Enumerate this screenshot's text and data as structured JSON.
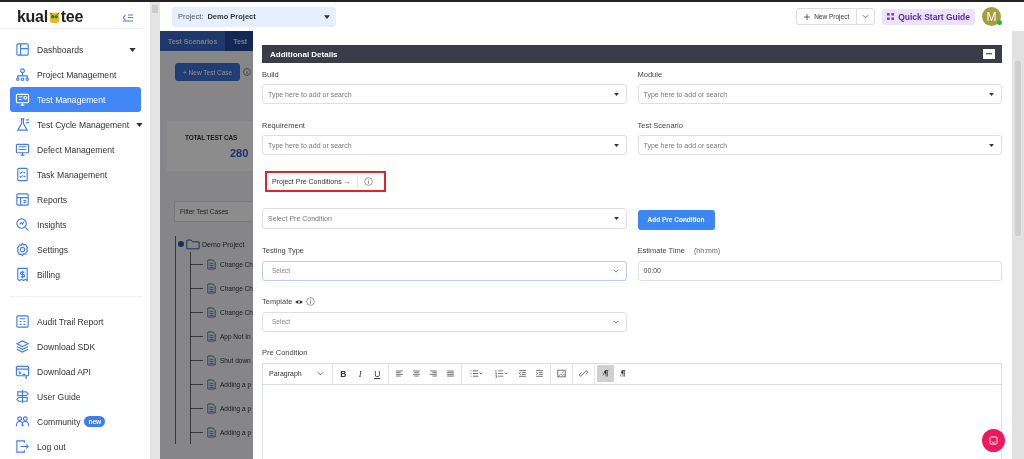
{
  "sidebar": {
    "logo": [
      "kual",
      "tee"
    ],
    "groups": [
      [
        {
          "label": "Dashboards",
          "selected": false,
          "caret": true
        },
        {
          "label": "Project Management",
          "selected": false,
          "caret": false
        },
        {
          "label": "Test Management",
          "selected": true,
          "caret": false
        },
        {
          "label": "Test Cycle Management",
          "selected": false,
          "caret": true
        },
        {
          "label": "Defect Management",
          "selected": false,
          "caret": false
        },
        {
          "label": "Task Management",
          "selected": false,
          "caret": false
        },
        {
          "label": "Reports",
          "selected": false,
          "caret": false
        },
        {
          "label": "Insights",
          "selected": false,
          "caret": false
        },
        {
          "label": "Settings",
          "selected": false,
          "caret": false
        },
        {
          "label": "Billing",
          "selected": false,
          "caret": false
        }
      ],
      [
        {
          "label": "Audit Trail Report",
          "selected": false,
          "caret": false
        },
        {
          "label": "Download SDK",
          "selected": false,
          "caret": false
        },
        {
          "label": "Download API",
          "selected": false,
          "caret": false
        },
        {
          "label": "User Guide",
          "selected": false,
          "caret": false
        },
        {
          "label": "Community",
          "selected": false,
          "caret": false,
          "badge": "new"
        },
        {
          "label": "Log out",
          "selected": false,
          "caret": false
        }
      ]
    ]
  },
  "topbar": {
    "project_label": "Project:",
    "project": "Demo Project",
    "new_project": "New Project",
    "quick_start": "Quick Start Guide",
    "avatar": "M",
    "online": true
  },
  "background": {
    "tabs": [
      {
        "label": "Test Scenarios",
        "selected": false
      },
      {
        "label": "Test",
        "selected": true
      }
    ],
    "new_test_case": "+ New Test Case",
    "total_label": "TOTAL TEST CAS",
    "total": "280",
    "filter_placeholder": "Filter Test Cases",
    "tree": {
      "label": "Demo Project",
      "expanded": true,
      "children": [
        {
          "label": "Change Ch"
        },
        {
          "label": "Change Ch"
        },
        {
          "label": "Change Ch"
        },
        {
          "label": "App Not In"
        },
        {
          "label": "Shut down"
        },
        {
          "label": "Adding a p"
        },
        {
          "label": "Adding a p"
        },
        {
          "label": "Adding a p"
        }
      ]
    }
  },
  "modal": {
    "title": "Additional Details",
    "rows": [
      {
        "kind": "fields",
        "items": [
          {
            "label": "Build",
            "kind": "combobox",
            "placeholder": "Type here to add or search",
            "focused": false
          },
          {
            "label": "Module",
            "kind": "combobox",
            "placeholder": "Type here to add or search",
            "focused": false
          }
        ]
      },
      {
        "kind": "fields",
        "items": [
          {
            "label": "Requirement",
            "kind": "combobox",
            "placeholder": "Type here to add or search",
            "focused": false
          },
          {
            "label": "Test Scenario",
            "kind": "combobox",
            "placeholder": "Type here to add or search",
            "focused": false
          }
        ]
      },
      {
        "kind": "link",
        "text": "Project Pre Conditions →",
        "highlighted": true
      },
      {
        "kind": "action",
        "placeholder": "Select Pre Condition",
        "button": "Add Pre Condition"
      },
      {
        "kind": "fields",
        "items": [
          {
            "label": "Testing Type",
            "kind": "select",
            "placeholder": "Select",
            "focused": true
          },
          {
            "label": "Estimate Time",
            "hint": "(hh:mm)",
            "kind": "text",
            "value": "00:00",
            "focused": false
          }
        ]
      },
      {
        "kind": "fields",
        "items": [
          {
            "label": "Template",
            "kind": "select",
            "placeholder": "Select",
            "focused": false,
            "preview_icon": true,
            "info_icon": true
          }
        ]
      },
      {
        "kind": "editor",
        "label": "Pre Condition",
        "block_format": "Paragraph",
        "marks": [
          "B",
          "I",
          "U"
        ],
        "directions": [
          {
            "selected": true
          },
          {
            "selected": false
          }
        ]
      }
    ]
  }
}
